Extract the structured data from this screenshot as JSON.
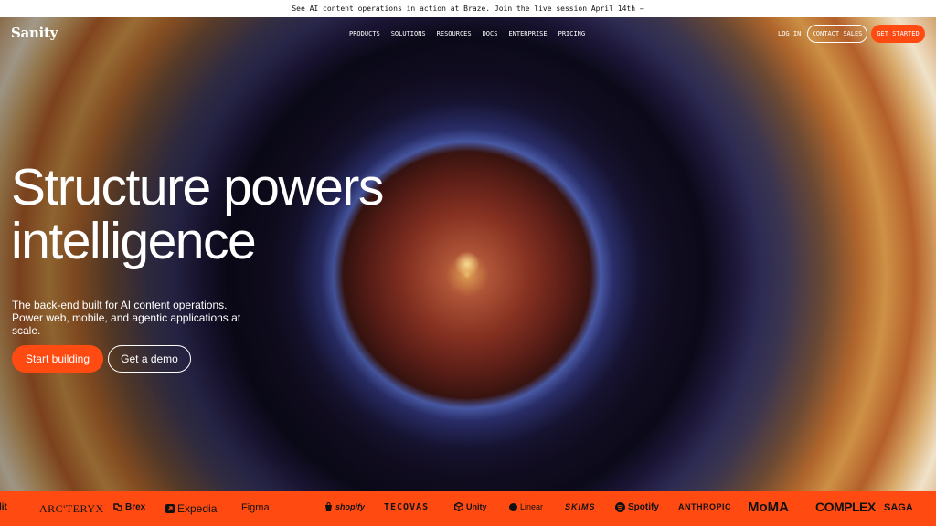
{
  "announcement": {
    "text": "See AI content operations in action at Braze. Join the live session April 14th →"
  },
  "nav": {
    "logo": "Sanity",
    "menu": [
      "PRODUCTS",
      "SOLUTIONS",
      "RESOURCES",
      "DOCS",
      "ENTERPRISE",
      "PRICING"
    ],
    "login": "LOG IN",
    "contact_sales": "CONTACT SALES",
    "get_started": "GET STARTED"
  },
  "hero": {
    "headline_line1": "Structure powers",
    "headline_line2": "intelligence",
    "subtext": "The back-end built for AI content operations. Power web, mobile, and agentic applications at scale.",
    "cta_primary": "Start building",
    "cta_secondary": "Get a demo"
  },
  "customer_logos": [
    "lit",
    "ARC'TERYX",
    "Brex",
    "Expedia",
    "Figma",
    "shopify",
    "TECOVAS",
    "Unity",
    "Linear",
    "SKIMS",
    "Spotify",
    "ANTHROPIC",
    "MoMA",
    "COMPLEX",
    "SAGA"
  ],
  "colors": {
    "accent": "#ff4b12",
    "text_light": "#ffffff",
    "banner_bg": "#ffffff"
  }
}
